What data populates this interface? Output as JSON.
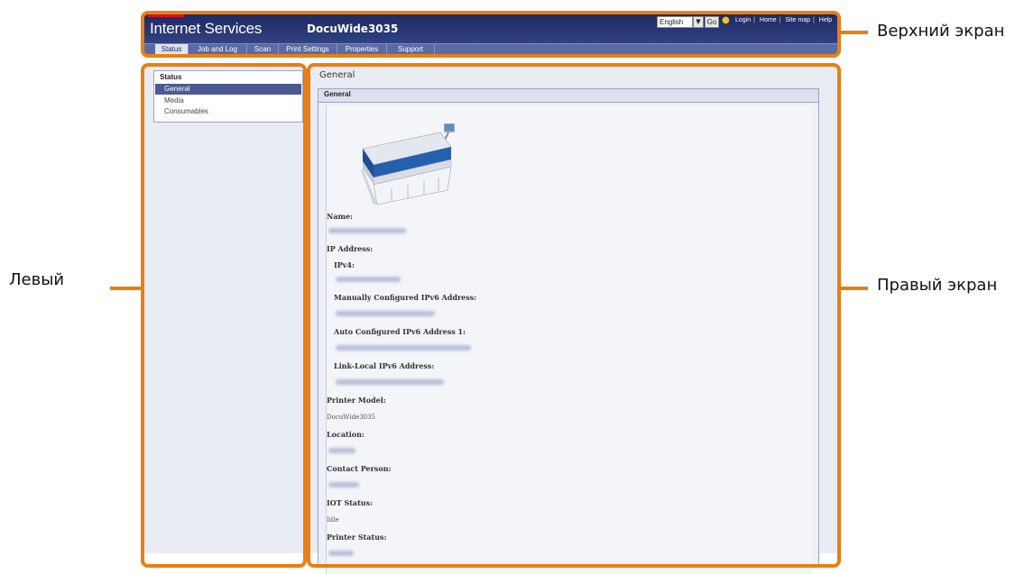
{
  "annotations": {
    "top_label": "Верхний экран",
    "left_label": "Левый",
    "right_label": "Правый экран"
  },
  "header": {
    "brand": "Internet Services",
    "device_name": "DocuWide3035",
    "language": "English",
    "go_label": "Go",
    "links": [
      "Login",
      "Home",
      "Site map",
      "Help"
    ]
  },
  "tabs": [
    "Status",
    "Job and Log",
    "Scan",
    "Print Settings",
    "Properties",
    "Support"
  ],
  "active_tab": "Status",
  "sidebar": {
    "heading": "Status",
    "items": [
      "General",
      "Media",
      "Consumables"
    ],
    "active_item": "General"
  },
  "main": {
    "page_title": "General",
    "section_title": "General",
    "fields": {
      "name_label": "Name:",
      "ip_address_label": "IP Address:",
      "ipv4_label": "IPv4:",
      "manual_ipv6_label": "Manually Configured IPv6 Address:",
      "auto_ipv6_label": "Auto Configured IPv6 Address 1:",
      "link_local_ipv6_label": "Link-Local IPv6 Address:",
      "printer_model_label": "Printer Model:",
      "printer_model_value": "DocuWide3035",
      "location_label": "Location:",
      "contact_person_label": "Contact Person:",
      "iot_status_label": "IOT Status:",
      "iot_status_value": "Idle",
      "printer_status_label": "Printer Status:"
    }
  },
  "colors": {
    "annotation_orange": "#e87f14",
    "header_navy": "#1f2a62",
    "active_nav": "#4a5a93"
  }
}
